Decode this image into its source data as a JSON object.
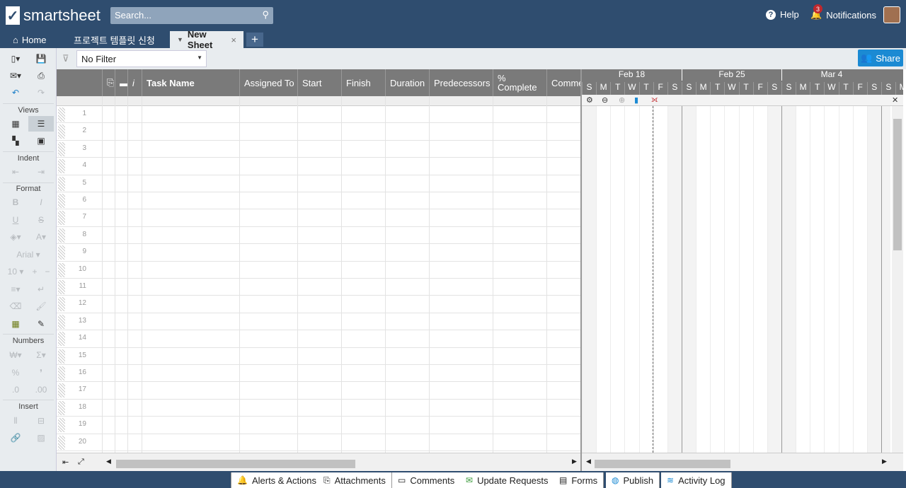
{
  "app": {
    "name": "smartsheet"
  },
  "search": {
    "placeholder": "Search..."
  },
  "header": {
    "help": "Help",
    "notifications": "Notifications",
    "notification_count": "3"
  },
  "tabs": [
    {
      "label": "Home"
    },
    {
      "label": "프로젝트 템플릿 신청"
    },
    {
      "label": "New Sheet"
    }
  ],
  "sidebar": {
    "views_label": "Views",
    "indent_label": "Indent",
    "format_label": "Format",
    "font_name": "Arial",
    "font_size": "10",
    "numbers_label": "Numbers",
    "insert_label": "Insert",
    "bold": "B",
    "italic": "I",
    "underline": "U",
    "strike": "S",
    "currency": "₩",
    "sum": "Σ",
    "percent": "%",
    "comma": "❜",
    "dec_less": ".0",
    "dec_more": ".00"
  },
  "filter": {
    "value": "No Filter"
  },
  "share": {
    "label": "Share"
  },
  "columns": {
    "task_name": "Task Name",
    "assigned_to": "Assigned To",
    "start": "Start",
    "finish": "Finish",
    "duration": "Duration",
    "predecessors": "Predecessors",
    "pct_complete": "% Complete",
    "comments": "Comme",
    "info": "i"
  },
  "rows": [
    "1",
    "2",
    "3",
    "4",
    "5",
    "6",
    "7",
    "8",
    "9",
    "10",
    "11",
    "12",
    "13",
    "14",
    "15",
    "16",
    "17",
    "18",
    "19",
    "20"
  ],
  "gantt": {
    "weeks": [
      "Feb 18",
      "Feb 25",
      "Mar 4"
    ],
    "days": [
      "S",
      "M",
      "T",
      "W",
      "T",
      "F",
      "S",
      "S",
      "M",
      "T",
      "W",
      "T",
      "F",
      "S",
      "S",
      "M",
      "T",
      "W",
      "T",
      "F",
      "S",
      "S",
      "M"
    ]
  },
  "footer": {
    "alerts": "Alerts & Actions",
    "attachments": "Attachments",
    "comments": "Comments",
    "update_requests": "Update Requests",
    "forms": "Forms",
    "publish": "Publish",
    "activity_log": "Activity Log"
  }
}
